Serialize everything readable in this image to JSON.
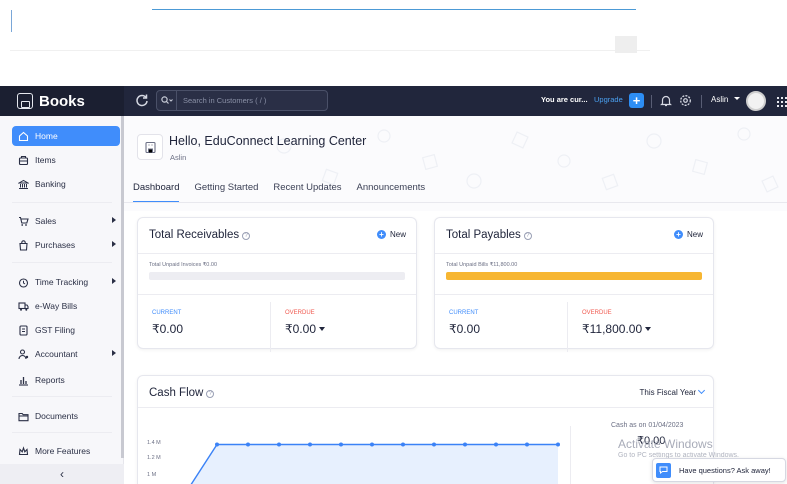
{
  "colors": {
    "header_bg": "#21263c",
    "accent": "#408dfb",
    "overdue": "#f05a50",
    "payables_bar": "#f7b632",
    "chart_line": "#3b82f6"
  },
  "header": {
    "brand": "Books",
    "search_placeholder": "Search in Customers ( / )",
    "trial_text": "You are cur...",
    "upgrade_label": "Upgrade",
    "user_name": "Aslin",
    "icons": [
      "refresh-icon",
      "search-icon",
      "plus-icon",
      "bell-icon",
      "gear-icon",
      "apps-grid-icon"
    ]
  },
  "sidebar": {
    "items": [
      {
        "label": "Home",
        "icon": "home-icon"
      },
      {
        "label": "Items",
        "icon": "items-icon"
      },
      {
        "label": "Banking",
        "icon": "bank-icon"
      },
      {
        "label": "Sales",
        "icon": "cart-icon"
      },
      {
        "label": "Purchases",
        "icon": "bag-icon"
      },
      {
        "label": "Time Tracking",
        "icon": "clock-icon"
      },
      {
        "label": "e-Way Bills",
        "icon": "truck-icon"
      },
      {
        "label": "GST Filing",
        "icon": "filing-icon"
      },
      {
        "label": "Accountant",
        "icon": "accountant-icon"
      },
      {
        "label": "Reports",
        "icon": "reports-icon"
      },
      {
        "label": "Documents",
        "icon": "folder-icon"
      },
      {
        "label": "More Features",
        "icon": "crown-icon"
      }
    ],
    "collapse_glyph": "‹"
  },
  "main": {
    "greeting": "Hello, EduConnect Learning Center",
    "sub_greeting": "Aslin",
    "tabs": [
      "Dashboard",
      "Getting Started",
      "Recent Updates",
      "Announcements"
    ],
    "receivables": {
      "title": "Total Receivables",
      "new_label": "New",
      "unpaid_label": "Total Unpaid Invoices ₹0.00",
      "progress": 0,
      "current_label": "CURRENT",
      "current_value": "₹0.00",
      "overdue_label": "OVERDUE",
      "overdue_value": "₹0.00"
    },
    "payables": {
      "title": "Total Payables",
      "new_label": "New",
      "unpaid_label": "Total Unpaid Bills ₹11,800.00",
      "progress": 1,
      "current_label": "CURRENT",
      "current_value": "₹0.00",
      "overdue_label": "OVERDUE",
      "overdue_value": "₹11,800.00"
    },
    "cash_flow": {
      "title": "Cash Flow",
      "period": "This Fiscal Year",
      "cash_as_on_label": "Cash as on 01/04/2023",
      "cash_as_on_value": "₹0.00"
    }
  },
  "chart_data": {
    "type": "line",
    "title": "Cash Flow",
    "y_tick_labels": [
      "1.4 M",
      "1.2 M",
      "1 M"
    ],
    "series": [
      {
        "values": [
          1.0,
          1.41,
          1.41,
          1.41,
          1.41,
          1.41,
          1.41,
          1.41,
          1.41,
          1.41,
          1.41,
          1.41,
          1.41
        ]
      }
    ],
    "ylim": [
      0.9,
      1.5
    ],
    "ylabel": ""
  },
  "overlay": {
    "watermark_line1": "Activate Windows",
    "watermark_line2": "Go to PC settings to activate Windows.",
    "help_chip": "Have questions? Ask away!"
  }
}
